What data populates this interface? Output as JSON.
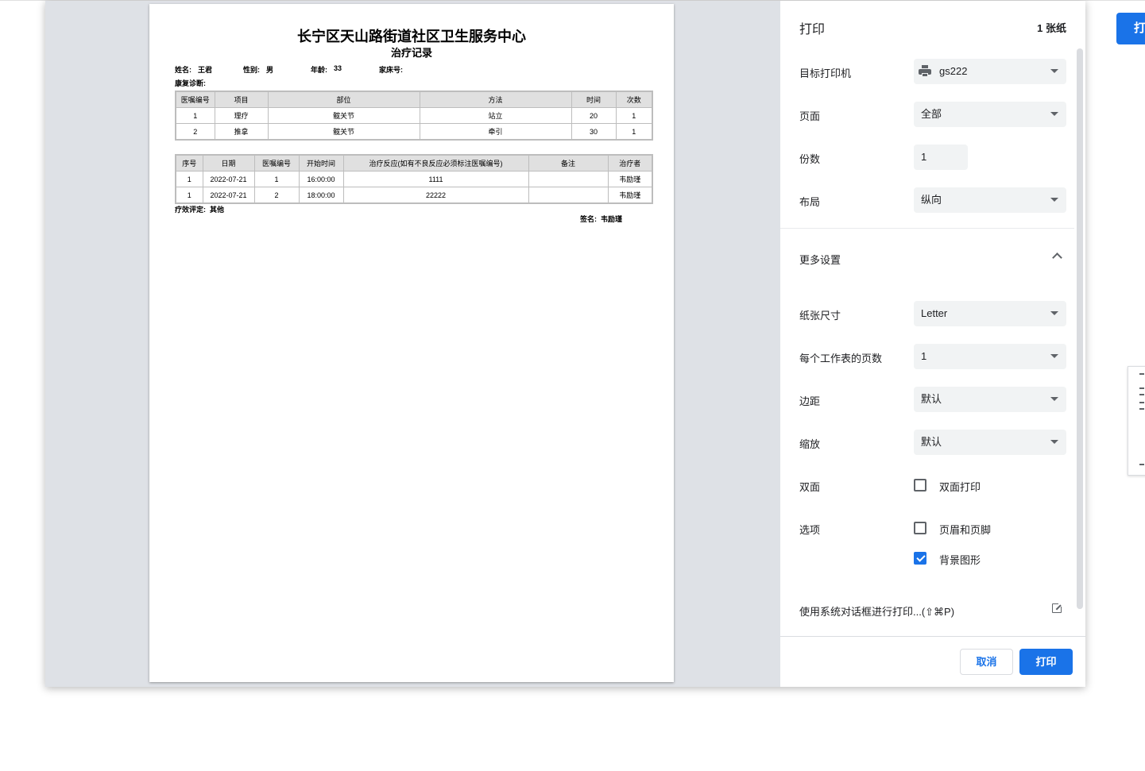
{
  "background": {
    "print_button_label": "打"
  },
  "document": {
    "title": "长宁区天山路街道社区卫生服务中心",
    "subtitle": "治疗记录",
    "info": {
      "name_label": "姓名:",
      "name": "王君",
      "gender_label": "性别:",
      "gender": "男",
      "age_label": "年龄:",
      "age": "33",
      "bed_label": "家床号:"
    },
    "diagnosis_label": "康复诊断:",
    "orders_table": {
      "headers": [
        "医嘱编号",
        "项目",
        "部位",
        "方法",
        "时间",
        "次数"
      ],
      "rows": [
        [
          "1",
          "理疗",
          "髋关节",
          "站立",
          "20",
          "1"
        ],
        [
          "2",
          "推拿",
          "髋关节",
          "牵引",
          "30",
          "1"
        ]
      ]
    },
    "records_table": {
      "headers": [
        "序号",
        "日期",
        "医嘱编号",
        "开始时间",
        "治疗反应(如有不良反应必须标注医嘱编号)",
        "备注",
        "治疗者"
      ],
      "rows": [
        [
          "1",
          "2022-07-21",
          "1",
          "16:00:00",
          "1111",
          "",
          "韦励瑾"
        ],
        [
          "1",
          "2022-07-21",
          "2",
          "18:00:00",
          "22222",
          "",
          "韦励瑾"
        ]
      ]
    },
    "effect_label": "疗效评定:",
    "effect_value": "其他",
    "sign_label": "签名:",
    "sign_value": "韦励瑾"
  },
  "panel": {
    "title": "打印",
    "sheet_count": "1 张纸",
    "destination_label": "目标打印机",
    "destination_value": "gs222",
    "pages_label": "页面",
    "pages_value": "全部",
    "copies_label": "份数",
    "copies_value": "1",
    "layout_label": "布局",
    "layout_value": "纵向",
    "more_settings_label": "更多设置",
    "paper_size_label": "纸张尺寸",
    "paper_size_value": "Letter",
    "pages_per_sheet_label": "每个工作表的页数",
    "pages_per_sheet_value": "1",
    "margins_label": "边距",
    "margins_value": "默认",
    "scale_label": "缩放",
    "scale_value": "默认",
    "duplex_label": "双面",
    "duplex_option": "双面打印",
    "duplex_checked": false,
    "options_label": "选项",
    "headers_footers_option": "页眉和页脚",
    "headers_footers_checked": false,
    "background_graphics_option": "背景图形",
    "background_graphics_checked": true,
    "system_dialog_link": "使用系统对话框进行打印...(⇧⌘P)",
    "cancel_button": "取消",
    "print_button": "打印"
  },
  "colors": {
    "accent": "#1a73e8",
    "preview_bg": "#dee1e6",
    "field_bg": "#f1f3f4"
  }
}
